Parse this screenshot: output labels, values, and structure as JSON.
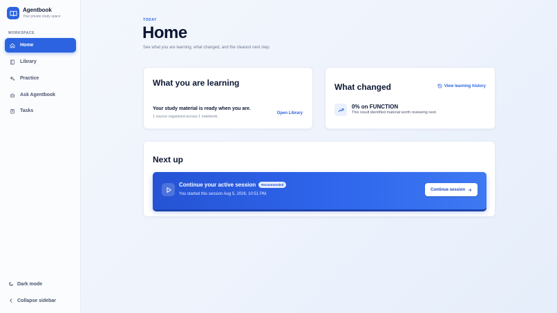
{
  "brand": {
    "name": "Agentbook",
    "tagline": "Your private study space"
  },
  "sidebar": {
    "section_label": "WORKSPACE",
    "items": [
      {
        "label": "Home",
        "icon": "home-icon",
        "active": true
      },
      {
        "label": "Library",
        "icon": "book-icon",
        "active": false
      },
      {
        "label": "Practice",
        "icon": "sparkle-icon",
        "active": false
      },
      {
        "label": "Ask Agentbook",
        "icon": "bot-icon",
        "active": false
      },
      {
        "label": "Tasks",
        "icon": "clipboard-icon",
        "active": false
      }
    ],
    "dark_mode_label": "Dark mode",
    "collapse_label": "Collapse sidebar"
  },
  "header": {
    "eyebrow": "TODAY",
    "title": "Home",
    "subtitle": "See what you are learning, what changed, and the clearest next step."
  },
  "learning": {
    "title": "What you are learning",
    "status": "Your study material is ready when you are.",
    "meta": "1 source organized across 1 notebook.",
    "link": "Open Library"
  },
  "changed": {
    "title": "What changed",
    "history_link": "View learning history",
    "headline": "0% on FUNCTION",
    "body": "This result identified material worth reviewing next."
  },
  "next_up": {
    "title": "Next up",
    "session_title": "Continue your active session",
    "badge": "Recommended",
    "session_meta": "You started this session Aug 5, 2026, 10:51 PM.",
    "button": "Continue session"
  },
  "colors": {
    "accent": "#2b63e0",
    "background": "#eef3fc"
  }
}
